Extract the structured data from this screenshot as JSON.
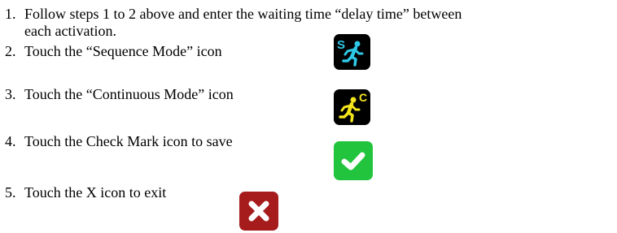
{
  "instructions": {
    "steps": [
      {
        "number": "1.",
        "text_line1": "Follow steps 1 to 2 above and enter the waiting time “delay time” between",
        "text_line2": "each activation."
      },
      {
        "number": "2.",
        "text": "Touch the “Sequence Mode” icon",
        "icon": "sequence-mode-icon"
      },
      {
        "number": "3.",
        "text": "Touch the “Continuous Mode” icon",
        "icon": "continuous-mode-icon"
      },
      {
        "number": "4.",
        "text": "Touch the Check Mark icon to save",
        "icon": "check-mark-icon"
      },
      {
        "number": "5.",
        "text": "Touch the X icon to exit",
        "icon": "x-icon"
      }
    ]
  },
  "icons": {
    "sequence_mode": {
      "letter": "S",
      "background": "#000000",
      "color": "#2ec8e6"
    },
    "continuous_mode": {
      "letter": "C",
      "background": "#000000",
      "color": "#f5e51c"
    },
    "check_mark": {
      "background": "#22c43d",
      "color": "#ffffff"
    },
    "x_exit": {
      "background": "#a61b1b",
      "color": "#ffffff"
    }
  }
}
